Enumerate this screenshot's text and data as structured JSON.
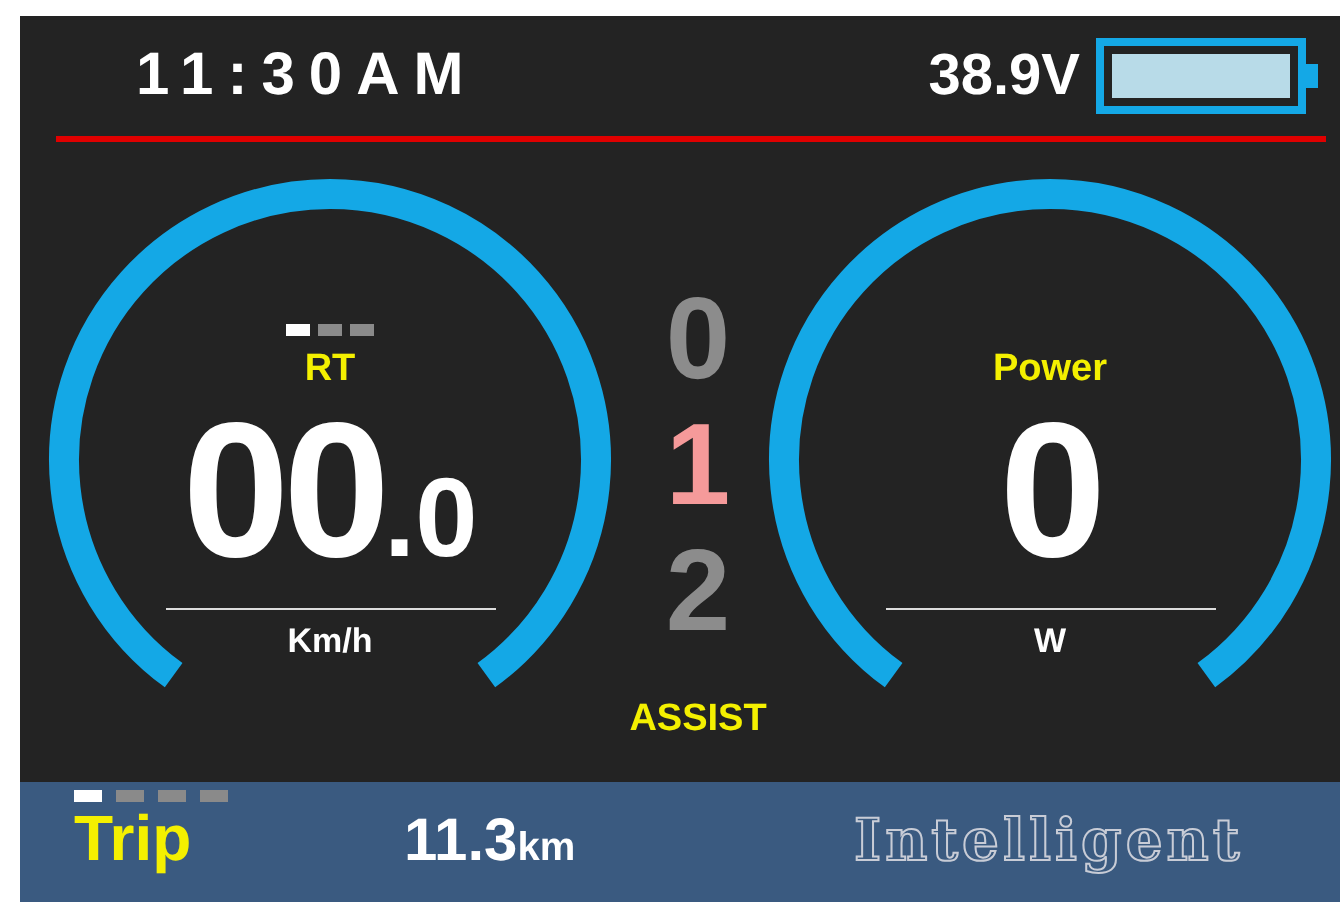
{
  "status_bar": {
    "time": "11:30AM",
    "voltage": "38.9V"
  },
  "speed_gauge": {
    "pages": [
      {
        "selected": true
      },
      {
        "selected": false
      },
      {
        "selected": false
      }
    ],
    "mode": "RT",
    "value": "00$_{.0}$",
    "unit": "Km/h"
  },
  "power_gauge": {
    "label": "Power",
    "value": "0",
    "unit": "W"
  },
  "assist": {
    "levels": [
      {
        "label": "0",
        "selected": false
      },
      {
        "label": "1",
        "selected": true
      },
      {
        "label": "2",
        "selected": false
      }
    ],
    "label": "ASSIST"
  },
  "trip_bar": {
    "pages": [
      {
        "selected": true
      },
      {
        "selected": false
      },
      {
        "selected": false
      },
      {
        "selected": false
      }
    ],
    "label": "Trip",
    "distance": "11.3$_{km}$",
    "mode": "Intelligent"
  }
}
